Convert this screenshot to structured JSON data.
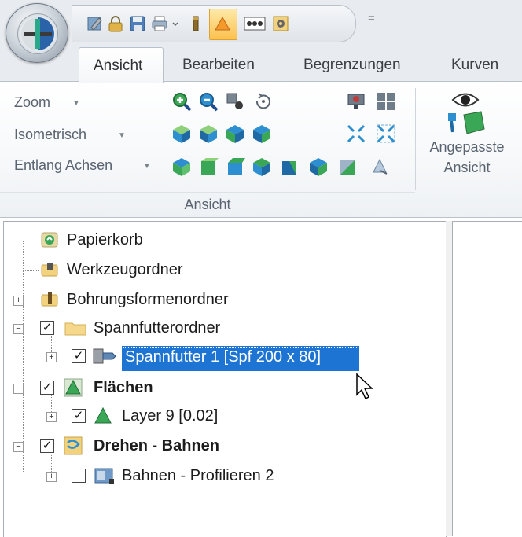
{
  "qat": {
    "icons": [
      "properties-icon",
      "lock-icon",
      "save-icon",
      "print-icon",
      "dropdown-small-icon",
      "bar-icon",
      "warning-shade-icon",
      "counter-icon",
      "settings-icon"
    ],
    "customize_glyph": "="
  },
  "tabs": [
    {
      "label": "Ansicht",
      "active": true
    },
    {
      "label": "Bearbeiten",
      "active": false
    },
    {
      "label": "Begrenzungen",
      "active": false
    },
    {
      "label": "Kurven",
      "active": false
    }
  ],
  "ribbon": {
    "zoom_label": "Zoom",
    "iso_label": "Isometrisch",
    "axes_label": "Entlang Achsen",
    "group_label": "Ansicht",
    "custom_view_line1": "Angepasste",
    "custom_view_line2": "Ansicht"
  },
  "tree": {
    "items": [
      {
        "label": "Papierkorb",
        "icon": "recycle-bin-icon"
      },
      {
        "label": "Werkzeugordner",
        "icon": "tool-folder-icon"
      },
      {
        "label": "Bohrungsformenordner",
        "icon": "hole-shape-folder-icon"
      },
      {
        "label": "Spannfutterordner",
        "icon": "folder-icon",
        "checked": true
      },
      {
        "label": "Spannfutter 1 [Spf 200 x 80]",
        "icon": "chuck-icon",
        "checked": true,
        "selected": true
      },
      {
        "label": "Flächen",
        "icon": "surfaces-icon",
        "checked": true,
        "bold": true
      },
      {
        "label": "Layer 9 [0.02]",
        "icon": "layer-icon",
        "checked": true
      },
      {
        "label": "Drehen - Bahnen",
        "icon": "turning-paths-icon",
        "checked": true,
        "bold": true
      },
      {
        "label": "Bahnen - Profilieren 2",
        "icon": "profile-path-icon",
        "checked": false
      }
    ]
  },
  "colors": {
    "selection": "#1e74d3",
    "ribbon_bg": "#e8ebef",
    "accent_green": "#3aa757",
    "accent_blue": "#2e8fd0"
  }
}
